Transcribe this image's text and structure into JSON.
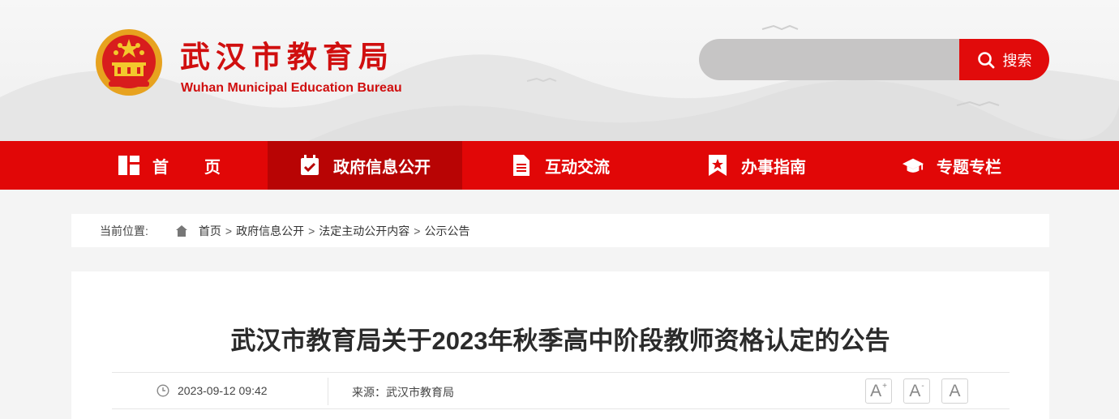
{
  "header": {
    "title": "武汉市教育局",
    "subtitle": "Wuhan Municipal Education Bureau",
    "search": {
      "placeholder": "",
      "button_label": "搜索"
    }
  },
  "nav": {
    "items": [
      {
        "label": "首页",
        "icon": "grid-icon",
        "active": false
      },
      {
        "label": "政府信息公开",
        "icon": "calendar-check-icon",
        "active": true
      },
      {
        "label": "互动交流",
        "icon": "document-icon",
        "active": false
      },
      {
        "label": "办事指南",
        "icon": "bookmark-star-icon",
        "active": false
      },
      {
        "label": "专题专栏",
        "icon": "graduation-cap-icon",
        "active": false
      }
    ]
  },
  "breadcrumb": {
    "label": "当前位置:",
    "items": [
      "首页",
      "政府信息公开",
      "法定主动公开内容",
      "公示公告"
    ],
    "separator": ">"
  },
  "article": {
    "title": "武汉市教育局关于2023年秋季高中阶段教师资格认定的公告",
    "datetime": "2023-09-12 09:42",
    "source_label": "来源：",
    "source": "武汉市教育局",
    "font_size_buttons": [
      "A+",
      "A-",
      "A"
    ]
  },
  "colors": {
    "brand_red": "#e10707",
    "active_nav": "#b80404",
    "title_red": "#d00f0f"
  }
}
